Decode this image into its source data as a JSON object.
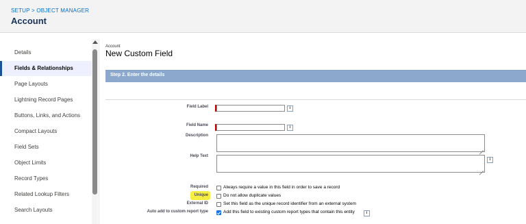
{
  "header": {
    "breadcrumb": [
      "SETUP",
      "OBJECT MANAGER"
    ],
    "title": "Account"
  },
  "sidebar": {
    "items": [
      {
        "label": "Details"
      },
      {
        "label": "Fields & Relationships",
        "active": true
      },
      {
        "label": "Page Layouts"
      },
      {
        "label": "Lightning Record Pages"
      },
      {
        "label": "Buttons, Links, and Actions"
      },
      {
        "label": "Compact Layouts"
      },
      {
        "label": "Field Sets"
      },
      {
        "label": "Object Limits"
      },
      {
        "label": "Record Types"
      },
      {
        "label": "Related Lookup Filters"
      },
      {
        "label": "Search Layouts"
      }
    ]
  },
  "main": {
    "object_label": "Account",
    "page_title": "New Custom Field",
    "step_title": "Step 2. Enter the details",
    "fields": {
      "field_label": {
        "label": "Field Label",
        "value": ""
      },
      "field_name": {
        "label": "Field Name",
        "value": ""
      },
      "description": {
        "label": "Description",
        "value": ""
      },
      "help_text": {
        "label": "Help Text",
        "value": ""
      }
    },
    "options": {
      "required": {
        "label": "Required",
        "text": "Always require a value in this field in order to save a record",
        "checked": false
      },
      "unique": {
        "label": "Unique",
        "text": "Do not allow duplicate values",
        "checked": false
      },
      "external_id": {
        "label": "External ID",
        "text": "Set this field as the unique record identifier from an external system",
        "checked": false
      },
      "auto_add": {
        "label": "Auto add to custom report type",
        "text": "Add this field to existing custom report types that contain this entity",
        "checked": true
      }
    },
    "info_glyph": "i"
  },
  "colors": {
    "step_bar": "#8ca9cd",
    "link": "#0070d2",
    "required_marker": "#cc0000",
    "highlight": "#f6ee41",
    "checkbox_checked": "#1a73e8"
  }
}
